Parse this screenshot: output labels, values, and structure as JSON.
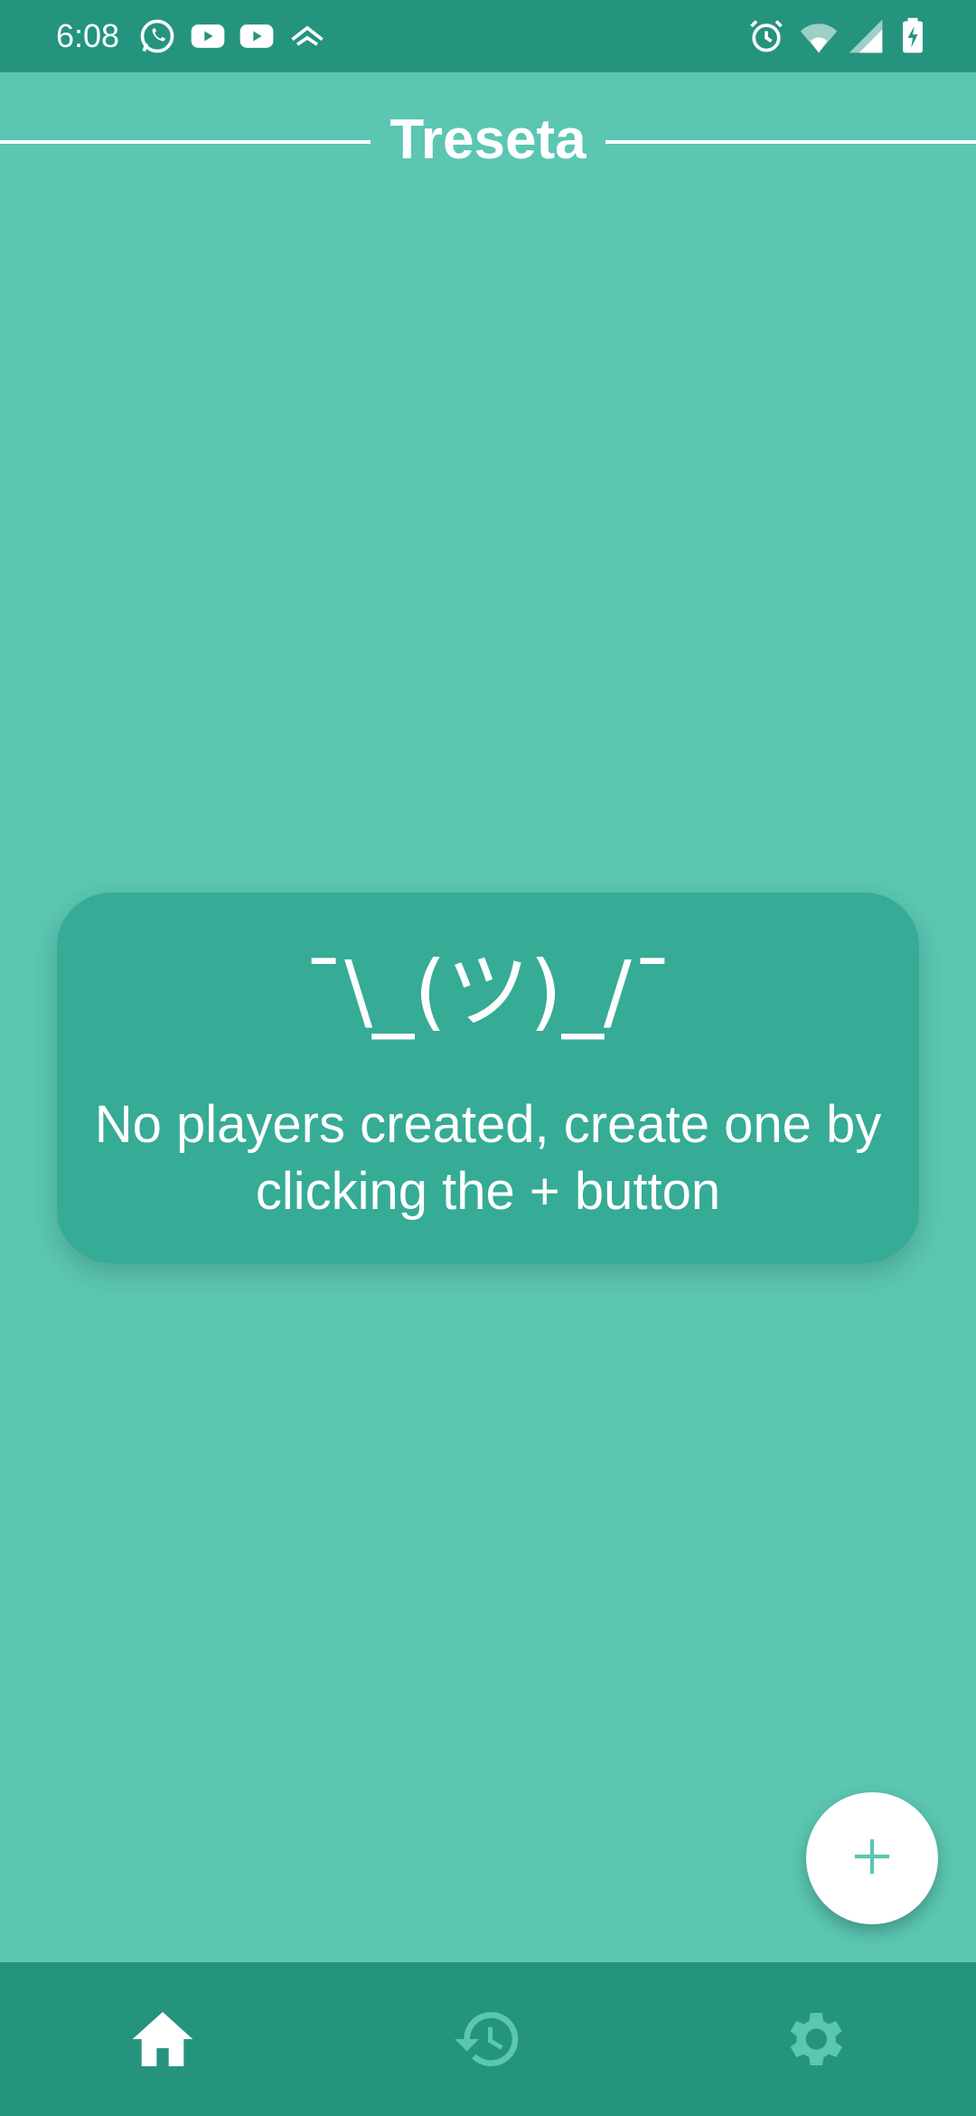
{
  "status_bar": {
    "time": "6:08",
    "left_icons": [
      "whatsapp-icon",
      "youtube-icon",
      "youtube-icon",
      "app-notification-icon"
    ],
    "right_icons": [
      "alarm-icon",
      "wifi-icon",
      "signal-icon",
      "battery-charging-icon"
    ]
  },
  "header": {
    "title": "Treseta"
  },
  "empty_state": {
    "emoticon": "¯\\_(ツ)_/¯",
    "message": "No players created, create one by clicking the + button"
  },
  "fab": {
    "icon": "plus-icon"
  },
  "bottom_nav": {
    "items": [
      {
        "icon": "home-icon",
        "active": true
      },
      {
        "icon": "history-icon",
        "active": false
      },
      {
        "icon": "gear-icon",
        "active": false
      }
    ]
  },
  "colors": {
    "background": "#5bc6b2",
    "bars": "#24947f",
    "card": "#36ab95",
    "nav_inactive": "#5bc6b2",
    "text": "#ffffff"
  }
}
